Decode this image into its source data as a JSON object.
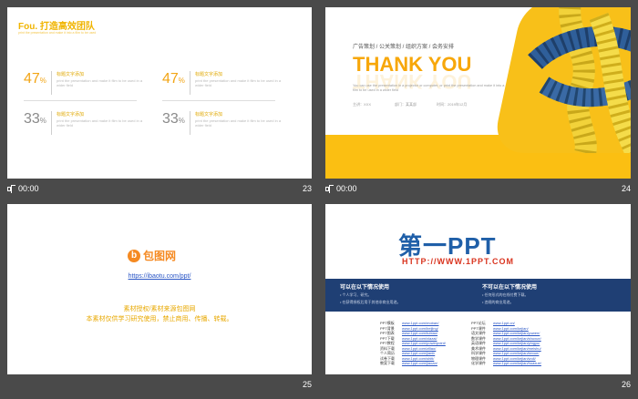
{
  "slides": [
    {
      "number": "23",
      "time": "00:00",
      "title": "Fou. 打造高效团队",
      "subtitle": "print the presentation and make it into a film to be used",
      "stats": [
        {
          "value": "47",
          "unit": "%",
          "label": "标题文字添加",
          "desc": "print the presentation and make it film to be used in a wider field"
        },
        {
          "value": "47",
          "unit": "%",
          "label": "标题文字添加",
          "desc": "print the presentation and make it film to be used in a wider field"
        },
        {
          "value": "33",
          "unit": "%",
          "label": "标题文字添加",
          "desc": "print the presentation and make it film to be used in a wider field"
        },
        {
          "value": "33",
          "unit": "%",
          "label": "标题文字添加",
          "desc": "print the presentation and make it film to be used in a wider field"
        }
      ]
    },
    {
      "number": "24",
      "time": "00:00",
      "nav": "广告策划 / 公关策划 / 组织方案 / 会务安排",
      "headline": "THANK YOU",
      "desc": "You can use the presentation in a projector or computer, or print the presentation and make it into a film to be used in a wider field",
      "meta": [
        "主讲：XXX",
        "部门：某某部",
        "时间：2019年12月"
      ]
    },
    {
      "number": "25",
      "logo_mark": "b",
      "logo_text": "包图网",
      "url": "https://ibaotu.com/ppt/",
      "line1": "素材授权/素材来源包图网",
      "line2": "本素材仅供学习研究使用，禁止商用、传播、转载。"
    },
    {
      "number": "26",
      "logo": "第一PPT",
      "url": "HTTP://WWW.1PPT.COM",
      "can_title": "可以在以下情况使用",
      "can_items": [
        "• 个人学习、研究。",
        "• 在获得授权后用于其他非商业用途。"
      ],
      "cannot_title": "不可以在以下情况使用",
      "cannot_items": [
        "• 任何形式的在线付费下载。",
        "• 违规的商业用途。"
      ],
      "links_left": [
        {
          "k": "PPT模板",
          "v": "www.1ppt.com/moban/"
        },
        {
          "k": "PPT背景",
          "v": "www.1ppt.com/beijing/"
        },
        {
          "k": "PPT图表",
          "v": "www.1ppt.com/tubiao/"
        },
        {
          "k": "PPT下载",
          "v": "www.1ppt.com/xiazai/"
        },
        {
          "k": "PPT教程",
          "v": "www.1ppt.com/powerpoint/"
        },
        {
          "k": "资料下载",
          "v": "www.1ppt.com/ziliao/"
        },
        {
          "k": "个人简历",
          "v": "www.1ppt.com/jianli/"
        },
        {
          "k": "试卷下载",
          "v": "www.1ppt.com/shiti/"
        },
        {
          "k": "教案下载",
          "v": "www.1ppt.com/jiaoan/"
        }
      ],
      "links_right": [
        {
          "k": "PPT论坛",
          "v": "www.1ppt.cn/"
        },
        {
          "k": "PPT课件",
          "v": "www.1ppt.com/kejian/"
        },
        {
          "k": "语文课件",
          "v": "www.1ppt.com/kejian/yuwen/"
        },
        {
          "k": "数学课件",
          "v": "www.1ppt.com/kejian/shuxue/"
        },
        {
          "k": "英语课件",
          "v": "www.1ppt.com/kejian/yingyu/"
        },
        {
          "k": "美术课件",
          "v": "www.1ppt.com/kejian/meishu/"
        },
        {
          "k": "科学课件",
          "v": "www.1ppt.com/kejian/kexue/"
        },
        {
          "k": "物理课件",
          "v": "www.1ppt.com/kejian/wuli/"
        },
        {
          "k": "化学课件",
          "v": "www.1ppt.com/kejian/huaxue/"
        }
      ]
    }
  ],
  "colors": {
    "accent": "#f0b400",
    "stat_orange": "#f2a516",
    "stat_grey": "#8a8a8a",
    "navy": "#1f3f74"
  }
}
